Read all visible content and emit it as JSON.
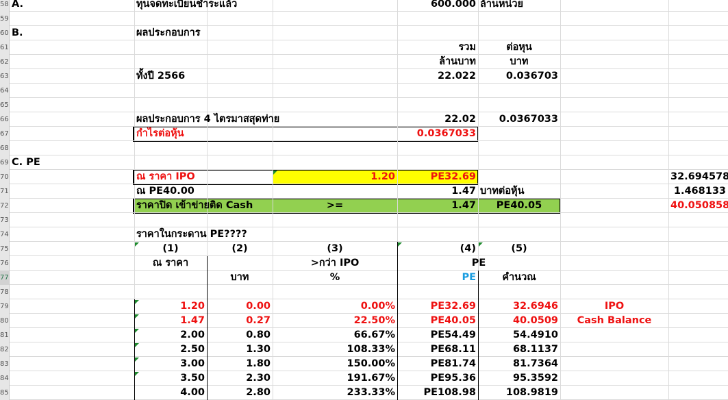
{
  "sheet": {
    "rows": [
      {
        "num": "58",
        "cells": {
          "a": "A.",
          "b": "ทุนจดทะเบียนชำระแล้ว",
          "f": "600.000",
          "g": "ล้านหน่วย"
        }
      },
      {
        "num": "59",
        "cells": {}
      },
      {
        "num": "60",
        "cells": {
          "a": "B.",
          "b": "ผลประกอบการ"
        }
      },
      {
        "num": "61",
        "cells": {
          "f": "รวม",
          "g": "ต่อหุน"
        }
      },
      {
        "num": "62",
        "cells": {
          "f": "ล้านบาท",
          "g": "บาท"
        }
      },
      {
        "num": "63",
        "cells": {
          "b": "ทั้งปี 2566",
          "f": "22.022",
          "g": "0.036703"
        }
      },
      {
        "num": "64",
        "cells": {}
      },
      {
        "num": "65",
        "cells": {}
      },
      {
        "num": "66",
        "cells": {
          "b": "ผลประกอบการ 4 ไตรมาสสุดท่าย",
          "f": "22.02",
          "g": "0.0367033"
        }
      },
      {
        "num": "67",
        "cells": {
          "b": "กำไรต่อหุ้น",
          "f": "0.0367033"
        }
      },
      {
        "num": "68",
        "cells": {}
      },
      {
        "num": "69",
        "cells": {
          "a": "C.  PE"
        }
      },
      {
        "num": "70",
        "cells": {
          "b": "ณ ราคา IPO",
          "d": "1.20",
          "f": "PE32.69",
          "i": "32.694578"
        }
      },
      {
        "num": "71",
        "cells": {
          "b": "ณ PE40.00",
          "f": "1.47",
          "g": "บาทต่อหุ้น",
          "i": "1.468133"
        }
      },
      {
        "num": "72",
        "cells": {
          "b": "ราคาปิด เข้าข่ายติด Cash",
          "d": ">=",
          "f": "1.47",
          "g": "PE40.05",
          "i": "40.050858"
        }
      },
      {
        "num": "73",
        "cells": {}
      },
      {
        "num": "74",
        "cells": {
          "b": "ราคาในกระดาน PE????"
        }
      },
      {
        "num": "75",
        "cells": {
          "b": "(1)",
          "c": "(2)",
          "d": "(3)",
          "f": "(4)",
          "g": "(5)"
        }
      },
      {
        "num": "76",
        "cells": {
          "b": "ณ ราคา",
          "d": ">กว่า IPO",
          "f": "PE"
        }
      },
      {
        "num": "77",
        "cells": {
          "c": "บาท",
          "d": "%",
          "f": "PE",
          "g": "คำนวณ"
        }
      },
      {
        "num": "78",
        "cells": {}
      },
      {
        "num": "79",
        "cells": {
          "b": "1.20",
          "c": "0.00",
          "d": "0.00%",
          "f": "PE32.69",
          "g": "32.6946",
          "h": "IPO"
        }
      },
      {
        "num": "80",
        "cells": {
          "b": "1.47",
          "c": "0.27",
          "d": "22.50%",
          "f": "PE40.05",
          "g": "40.0509",
          "h": "Cash Balance"
        }
      },
      {
        "num": "81",
        "cells": {
          "b": "2.00",
          "c": "0.80",
          "d": "66.67%",
          "f": "PE54.49",
          "g": "54.4910"
        }
      },
      {
        "num": "82",
        "cells": {
          "b": "2.50",
          "c": "1.30",
          "d": "108.33%",
          "f": "PE68.11",
          "g": "68.1137"
        }
      },
      {
        "num": "83",
        "cells": {
          "b": "3.00",
          "c": "1.80",
          "d": "150.00%",
          "f": "PE81.74",
          "g": "81.7364"
        }
      },
      {
        "num": "84",
        "cells": {
          "b": "3.50",
          "c": "2.30",
          "d": "191.67%",
          "f": "PE95.36",
          "g": "95.3592"
        }
      },
      {
        "num": "85",
        "cells": {
          "b": "4.00",
          "c": "2.80",
          "d": "233.33%",
          "f": "PE108.98",
          "g": "108.9819"
        }
      }
    ]
  },
  "colors": {
    "red": "#ee1111",
    "blue": "#1a9de0",
    "yellow": "#ffff00",
    "green": "#92d050"
  }
}
